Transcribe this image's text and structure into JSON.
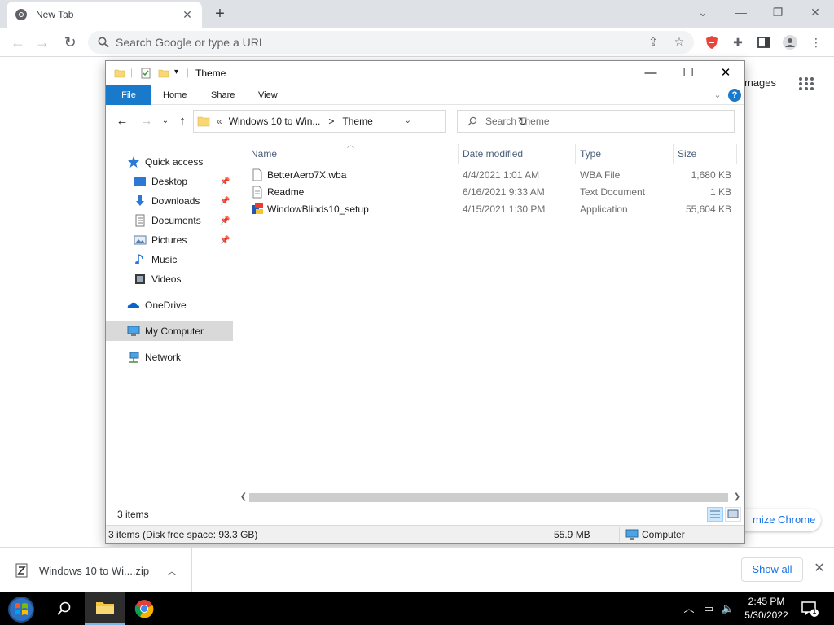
{
  "chrome": {
    "tab_title": "New Tab",
    "omnibox_placeholder": "Search Google or type a URL",
    "images_link": "mages",
    "customize_label": "mize Chrome"
  },
  "explorer": {
    "title": "Theme",
    "ribbon": {
      "file": "File",
      "home": "Home",
      "share": "Share",
      "view": "View",
      "help": "?"
    },
    "address": {
      "prefix": "«",
      "parent": "Windows 10 to Win...",
      "sep": ">",
      "current": "Theme"
    },
    "search_placeholder": "Search Theme",
    "nav": [
      {
        "label": "Quick access",
        "icon": "star-icon",
        "pinned": false
      },
      {
        "label": "Desktop",
        "icon": "desktop-folder-icon",
        "pinned": true
      },
      {
        "label": "Downloads",
        "icon": "downloads-folder-icon",
        "pinned": true
      },
      {
        "label": "Documents",
        "icon": "documents-folder-icon",
        "pinned": true
      },
      {
        "label": "Pictures",
        "icon": "pictures-folder-icon",
        "pinned": true
      },
      {
        "label": "Music",
        "icon": "music-folder-icon",
        "pinned": false
      },
      {
        "label": "Videos",
        "icon": "videos-folder-icon",
        "pinned": false
      },
      {
        "label": "OneDrive",
        "icon": "onedrive-icon",
        "pinned": false
      },
      {
        "label": "My Computer",
        "icon": "computer-icon",
        "pinned": false,
        "selected": true
      },
      {
        "label": "Network",
        "icon": "network-icon",
        "pinned": false
      }
    ],
    "columns": {
      "name": "Name",
      "date": "Date modified",
      "type": "Type",
      "size": "Size"
    },
    "files": [
      {
        "name": "BetterAero7X.wba",
        "date": "4/4/2021 1:01 AM",
        "type": "WBA File",
        "size": "1,680 KB",
        "icon": "file-icon"
      },
      {
        "name": "Readme",
        "date": "6/16/2021 9:33 AM",
        "type": "Text Document",
        "size": "1 KB",
        "icon": "text-file-icon"
      },
      {
        "name": "WindowBlinds10_setup",
        "date": "4/15/2021 1:30 PM",
        "type": "Application",
        "size": "55,604 KB",
        "icon": "installer-icon"
      }
    ],
    "item_count": "3 items",
    "status": {
      "left": "3 items (Disk free space: 93.3 GB)",
      "size": "55.9 MB",
      "location": "Computer"
    }
  },
  "downloads": {
    "item_name": "Windows 10 to Wi....zip",
    "show_all": "Show all"
  },
  "taskbar": {
    "time": "2:45 PM",
    "date": "5/30/2022",
    "notif_count": "1"
  },
  "colors": {
    "accent": "#1979ca",
    "chrome_frame": "#dee1e6",
    "taskbar": "#000000"
  }
}
